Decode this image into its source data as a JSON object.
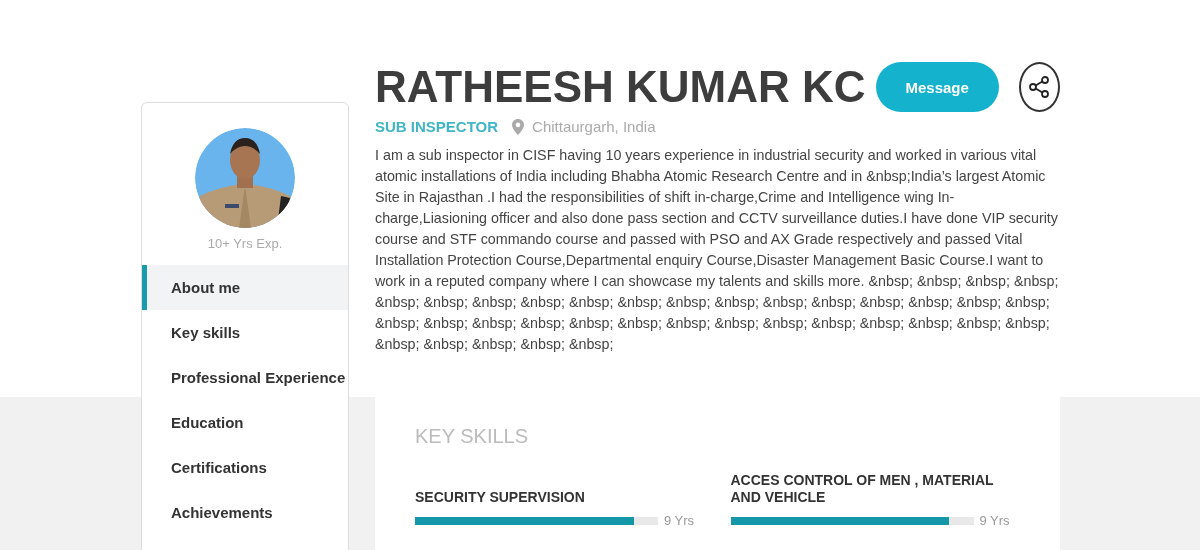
{
  "profile": {
    "name": "RATHEESH KUMAR KC",
    "title": "SUB INSPECTOR",
    "location": "Chittaurgarh, India",
    "experience": "10+ Yrs Exp.",
    "about": "I am a sub inspector in CISF having 10 years experience in industrial security and worked in various vital atomic installations of India including Bhabha Atomic Research Centre and in &nbsp;India’s largest Atomic Site in Rajasthan .I had the responsibilities of shift in-charge,Crime and Intelligence wing In-charge,Liasioning officer and also done pass section and CCTV surveillance duties.I have done VIP security course and STF commando course and passed with PSO and AX Grade respectively and passed Vital Installation Protection Course,Departmental enquiry Course,Disaster Management Basic Course.I want to work in a reputed company where I can showcase my talents and skills more. &nbsp; &nbsp; &nbsp; &nbsp; &nbsp; &nbsp; &nbsp; &nbsp; &nbsp; &nbsp; &nbsp; &nbsp; &nbsp; &nbsp; &nbsp; &nbsp; &nbsp; &nbsp; &nbsp; &nbsp; &nbsp; &nbsp; &nbsp; &nbsp; &nbsp; &nbsp; &nbsp; &nbsp; &nbsp; &nbsp; &nbsp; &nbsp; &nbsp; &nbsp; &nbsp; &nbsp; &nbsp;"
  },
  "actions": {
    "message_button": "Message"
  },
  "sidebar": {
    "items": [
      {
        "label": "About me",
        "selected": true
      },
      {
        "label": "Key skills",
        "selected": false
      },
      {
        "label": "Professional Experience",
        "selected": false
      },
      {
        "label": "Education",
        "selected": false
      },
      {
        "label": "Certifications",
        "selected": false
      },
      {
        "label": "Achievements",
        "selected": false
      }
    ]
  },
  "key_skills": {
    "title": "KEY SKILLS",
    "skills": [
      {
        "name": "SECURITY SUPERVISION",
        "level": 0.9,
        "reading": "9 Yrs"
      },
      {
        "name": "ACCES CONTROL OF MEN , MATERIAL AND VEHICLE",
        "level": 0.9,
        "reading": "9 Yrs"
      }
    ]
  }
}
